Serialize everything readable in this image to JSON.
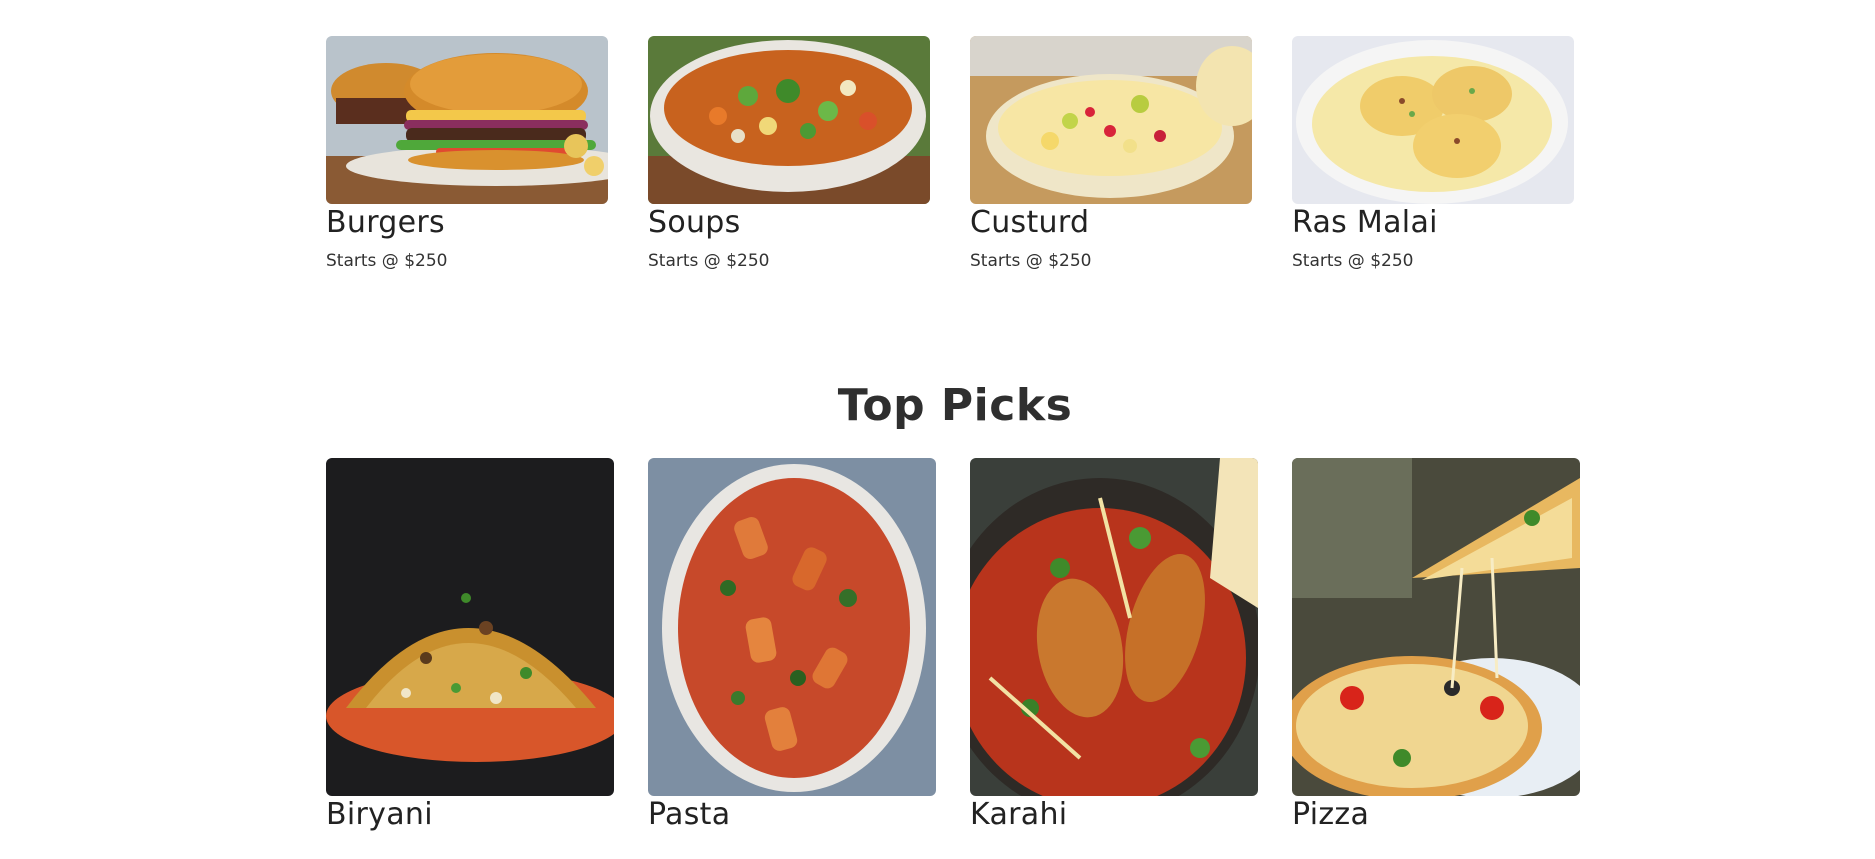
{
  "categories": {
    "items": [
      {
        "title": "Burgers",
        "price": "Starts @ $250",
        "image": "burger-photo"
      },
      {
        "title": "Soups",
        "price": "Starts @ $250",
        "image": "soup-photo"
      },
      {
        "title": "Custurd",
        "price": "Starts @ $250",
        "image": "custard-photo"
      },
      {
        "title": "Ras Malai",
        "price": "Starts @ $250",
        "image": "ras-malai-photo"
      }
    ]
  },
  "top_picks": {
    "heading": "Top Picks",
    "items": [
      {
        "title": "Biryani",
        "image": "biryani-photo"
      },
      {
        "title": "Pasta",
        "image": "pasta-photo"
      },
      {
        "title": "Karahi",
        "image": "karahi-photo"
      },
      {
        "title": "Pizza",
        "image": "pizza-photo"
      }
    ]
  },
  "colors": {
    "background": "#ffffff",
    "text": "#222222",
    "heading": "#2f2f2f"
  }
}
